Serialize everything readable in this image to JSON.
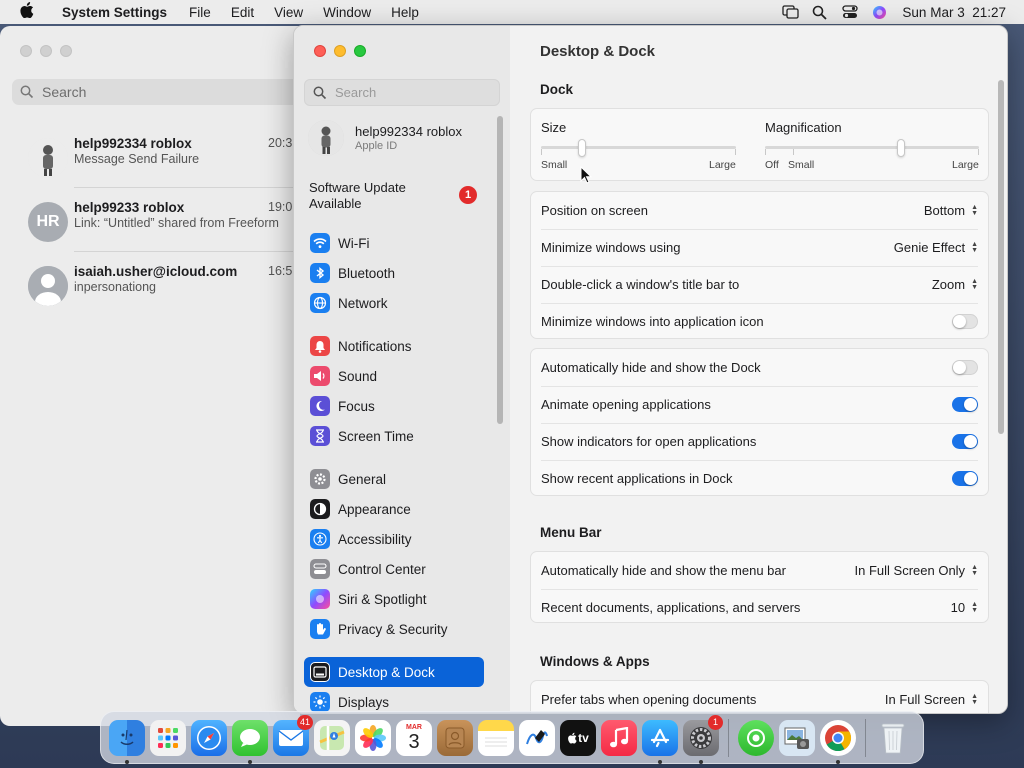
{
  "menubar": {
    "app_name": "System Settings",
    "menus": [
      "File",
      "Edit",
      "View",
      "Window",
      "Help"
    ],
    "clock": "Sun Mar 3  21:27"
  },
  "messages": {
    "search_placeholder": "Search",
    "conversations": [
      {
        "name": "help992334 roblox",
        "preview": "Message Send Failure",
        "time": "20:3"
      },
      {
        "name": "help99233 roblox",
        "preview": "Link: “Untitled” shared from Freeform",
        "time": "19:0",
        "initials": "HR"
      },
      {
        "name": "isaiah.usher@icloud.com",
        "preview": "inpersonationg",
        "time": "16:5"
      }
    ]
  },
  "sidebar": {
    "search_placeholder": "Search",
    "account": {
      "name": "help992334 roblox",
      "subtitle": "Apple ID"
    },
    "software_update": {
      "label": "Software Update Available",
      "badge": "1"
    },
    "items": [
      {
        "label": "Wi-Fi",
        "icon": "wifi-icon",
        "color": "#1a7ff0"
      },
      {
        "label": "Bluetooth",
        "icon": "bluetooth-icon",
        "color": "#1a7ff0"
      },
      {
        "label": "Network",
        "icon": "globe-icon",
        "color": "#1a7ff0"
      },
      {
        "label": "Notifications",
        "icon": "bell-icon",
        "color": "#ec4646"
      },
      {
        "label": "Sound",
        "icon": "speaker-icon",
        "color": "#ec4b6d"
      },
      {
        "label": "Focus",
        "icon": "moon-icon",
        "color": "#5b4fd6"
      },
      {
        "label": "Screen Time",
        "icon": "hourglass-icon",
        "color": "#5b4fd6"
      },
      {
        "label": "General",
        "icon": "gear-icon",
        "color": "#8e8e93"
      },
      {
        "label": "Appearance",
        "icon": "appearance-icon",
        "color": "#1c1c1e"
      },
      {
        "label": "Accessibility",
        "icon": "accessibility-icon",
        "color": "#1a7ff0"
      },
      {
        "label": "Control Center",
        "icon": "control-center-icon",
        "color": "#8e8e93"
      },
      {
        "label": "Siri & Spotlight",
        "icon": "siri-icon",
        "color": "#3a3a8c"
      },
      {
        "label": "Privacy & Security",
        "icon": "hand-icon",
        "color": "#1a7ff0"
      },
      {
        "label": "Desktop & Dock",
        "icon": "dock-icon",
        "color": "#1c1c1e"
      },
      {
        "label": "Displays",
        "icon": "sun-icon",
        "color": "#1a7ff0"
      }
    ]
  },
  "content": {
    "title": "Desktop & Dock",
    "dock_section": "Dock",
    "size": {
      "label": "Size",
      "min_label": "Small",
      "max_label": "Large",
      "value": 0.2
    },
    "magnification": {
      "label": "Magnification",
      "off_label": "Off",
      "min_label": "Small",
      "max_label": "Large",
      "value": 0.64
    },
    "rows1": [
      {
        "label": "Position on screen",
        "value": "Bottom"
      },
      {
        "label": "Minimize windows using",
        "value": "Genie Effect"
      },
      {
        "label": "Double-click a window's title bar to",
        "value": "Zoom"
      },
      {
        "label": "Minimize windows into application icon",
        "toggle": false
      }
    ],
    "rows2": [
      {
        "label": "Automatically hide and show the Dock",
        "toggle": false
      },
      {
        "label": "Animate opening applications",
        "toggle": true
      },
      {
        "label": "Show indicators for open applications",
        "toggle": true
      },
      {
        "label": "Show recent applications in Dock",
        "toggle": true
      }
    ],
    "menubar_section": "Menu Bar",
    "rows3": [
      {
        "label": "Automatically hide and show the menu bar",
        "value": "In Full Screen Only"
      },
      {
        "label": "Recent documents, applications, and servers",
        "value": "10"
      }
    ],
    "windows_section": "Windows & Apps",
    "rows4": [
      {
        "label": "Prefer tabs when opening documents",
        "value": "In Full Screen"
      }
    ]
  },
  "dock": {
    "mail_badge": "41",
    "calendar_month": "MAR",
    "calendar_day": "3",
    "settings_badge": "1",
    "tv_label": "tv"
  }
}
